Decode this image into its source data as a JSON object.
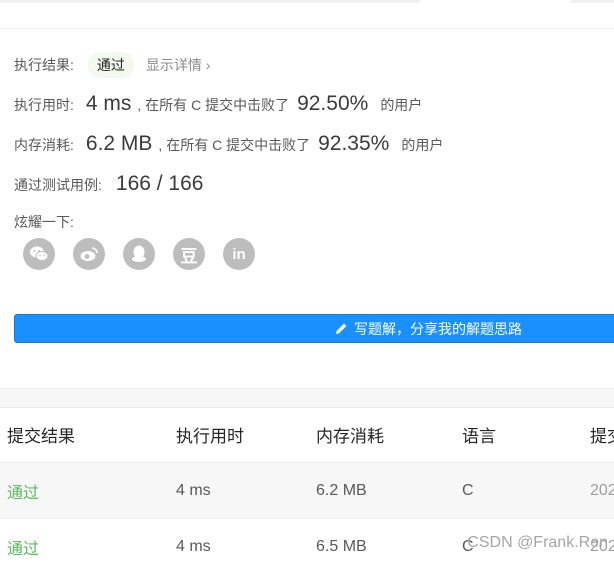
{
  "result": {
    "label": "执行结果:",
    "status": "通过",
    "details_link": "显示详情 ›"
  },
  "runtime": {
    "label": "执行用时:",
    "value": "4 ms",
    "text1": ", 在所有 C 提交中击败了",
    "percent": "92.50%",
    "text2": "的用户"
  },
  "memory": {
    "label": "内存消耗:",
    "value": "6.2 MB",
    "text1": ", 在所有 C 提交中击败了",
    "percent": "92.35%",
    "text2": "的用户"
  },
  "tests": {
    "label": "通过测试用例:",
    "value": "166 / 166"
  },
  "share": {
    "label": "炫耀一下:",
    "icons": [
      "wechat-icon",
      "weibo-icon",
      "qq-icon",
      "douban-icon",
      "linkedin-icon"
    ],
    "douban_glyph": "豆",
    "linkedin_glyph": "in"
  },
  "solution_button": {
    "label": "写题解，分享我的解题思路"
  },
  "table": {
    "headers": [
      "提交结果",
      "执行用时",
      "内存消耗",
      "语言",
      "提交"
    ],
    "rows": [
      [
        "通过",
        "4 ms",
        "6.2 MB",
        "C",
        "202"
      ],
      [
        "通过",
        "4 ms",
        "6.5 MB",
        "C",
        "202"
      ]
    ]
  },
  "watermark": "CSDN @Frank.Ren",
  "colors": {
    "accent": "#1a90ff",
    "success": "#5cb85c"
  }
}
